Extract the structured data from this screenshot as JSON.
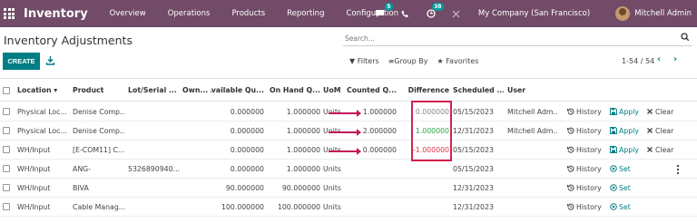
{
  "nav": {
    "brand": "Inventory",
    "menu": [
      "Overview",
      "Operations",
      "Products",
      "Reporting",
      "Configuration"
    ],
    "chat_badge": "5",
    "activity_badge": "38",
    "company": "My Company (San Francisco)",
    "user": "Mitchell Admin"
  },
  "page": {
    "title": "Inventory Adjustments",
    "search_placeholder": "Search...",
    "create_label": "CREATE",
    "filters_label": "Filters",
    "group_by_label": "Group By",
    "favorites_label": "Favorites",
    "pager": "1-54 / 54"
  },
  "table": {
    "headers": {
      "location": "Location",
      "product": "Product",
      "lot": "Lot/Serial ...",
      "owner": "Own...",
      "available": "Available Qu...",
      "on_hand": "On Hand Q...",
      "uom": "UoM",
      "counted": "Counted Q...",
      "difference": "Difference",
      "scheduled": "Scheduled ...",
      "user": "User"
    },
    "rows": [
      {
        "location": "Physical Loc...",
        "product": "Denise Comp...",
        "lot": "",
        "owner": "",
        "available": "0.000000",
        "on_hand": "1.000000",
        "uom": "Units",
        "counted": "1.000000",
        "difference": "0.000000",
        "diff_type": "zero",
        "scheduled": "05/15/2023",
        "user": "Mitchell Adm...",
        "history": "History",
        "action": "Apply",
        "clear": "Clear"
      },
      {
        "location": "Physical Loc...",
        "product": "Denise Comp...",
        "lot": "",
        "owner": "",
        "available": "0.000000",
        "on_hand": "1.000000",
        "uom": "Units",
        "counted": "2.000000",
        "difference": "1.000000",
        "diff_type": "pos",
        "scheduled": "12/31/2023",
        "user": "Mitchell Adm...",
        "history": "History",
        "action": "Apply",
        "clear": "Clear"
      },
      {
        "location": "WH/Input",
        "product": "[E-COM11] C...",
        "lot": "",
        "owner": "",
        "available": "0.000000",
        "on_hand": "1.000000",
        "uom": "Units",
        "counted": "0.000000",
        "difference": "-1.000000",
        "diff_type": "neg",
        "scheduled": "05/15/2023",
        "user": "",
        "history": "History",
        "action": "Apply",
        "clear": "Clear"
      },
      {
        "location": "WH/Input",
        "product": "ANG-",
        "lot": "5326890940...",
        "owner": "",
        "available": "0.000000",
        "on_hand": "1.000000",
        "uom": "Units",
        "counted": "",
        "difference": "",
        "diff_type": "",
        "scheduled": "05/15/2023",
        "user": "",
        "history": "History",
        "action": "Set",
        "clear": ""
      },
      {
        "location": "WH/Input",
        "product": "BIVA",
        "lot": "",
        "owner": "",
        "available": "90.000000",
        "on_hand": "90.000000",
        "uom": "Units",
        "counted": "",
        "difference": "",
        "diff_type": "",
        "scheduled": "12/31/2023",
        "user": "",
        "history": "History",
        "action": "Set",
        "clear": ""
      },
      {
        "location": "WH/Input",
        "product": "Cable Manag...",
        "lot": "",
        "owner": "",
        "available": "100.000000",
        "on_hand": "100.000000",
        "uom": "Units",
        "counted": "",
        "difference": "",
        "diff_type": "",
        "scheduled": "12/31/2023",
        "user": "",
        "history": "History",
        "action": "Set",
        "clear": ""
      }
    ]
  },
  "colors": {
    "navbar": "#714B67",
    "primary": "#017E84",
    "highlight": "#d0234f"
  }
}
